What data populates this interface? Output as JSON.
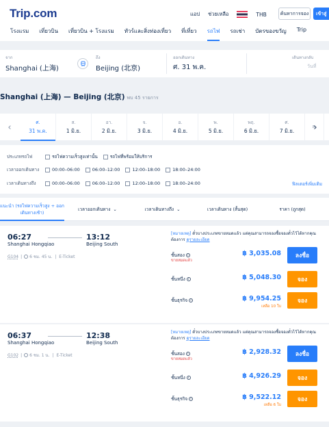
{
  "header": {
    "logo": "Trip.com",
    "links": [
      "แอป",
      "ช่วยเหลือ",
      "THB"
    ],
    "order_label": "ค้นหาการจอง",
    "login_label": "เข้าสู่"
  },
  "nav": [
    "โรงแรม",
    "เที่ยวบิน",
    "เที่ยวบิน + โรงแรม",
    "ทัวร์และสิ่งท่องเที่ยว",
    "ที่เที่ยว",
    "รถไฟ",
    "รถเช่า",
    "บัตรของขวัญ",
    "Trip"
  ],
  "search": {
    "from_label": "จาก",
    "from_value": "Shanghai (上海)",
    "to_label": "ถึง",
    "to_value": "Beijing (北京)",
    "depart_label": "ออกเดินทาง",
    "depart_value": "ศ. 31 พ.ค.",
    "return_label": "เดินทางกลับ",
    "return_value": "วันที่"
  },
  "route": {
    "title": "Shanghai (上海) — Beijing (北京)",
    "count": "พบ 45 รายการ"
  },
  "dates": [
    {
      "dow": "ศ.",
      "day": "31 พ.ค."
    },
    {
      "dow": "ส.",
      "day": "1 มิ.ย."
    },
    {
      "dow": "อา.",
      "day": "2 มิ.ย."
    },
    {
      "dow": "จ.",
      "day": "3 มิ.ย."
    },
    {
      "dow": "อ.",
      "day": "4 มิ.ย."
    },
    {
      "dow": "พ.",
      "day": "5 มิ.ย."
    },
    {
      "dow": "พฤ.",
      "day": "6 มิ.ย."
    },
    {
      "dow": "ศ.",
      "day": "7 มิ.ย."
    },
    {
      "dow": "ส.",
      "day": ""
    }
  ],
  "filters": {
    "type_label": "ประเภทรถไฟ",
    "type_opts": [
      "รถไฟความเร็วสูงเท่านั้น",
      "รถไฟที่พร้อมให้บริการ"
    ],
    "depart_label": "เวลาออกเดินทาง",
    "arrive_label": "เวลาเดินทางถึง",
    "time_opts": [
      "00:00–06:00",
      "06:00–12:00",
      "12:00–18:00",
      "18:00–24:00"
    ],
    "more": "ฟิลเตอร์เพิ่มเติม"
  },
  "sort": [
    "แนะนำ (รถไฟความเร็วสูง + ออกเดินทางเช้า)",
    "เวลาออกเดินทาง",
    "เวลาเดินทางถึง",
    "เวลาเดินทาง (สั้นสุด)",
    "ราคา (ถูกสุด)"
  ],
  "trains": [
    {
      "dep": "06:27",
      "arr": "13:12",
      "from": "Shanghai Hongqiao",
      "to": "Beijing South",
      "no": "G104",
      "dur": "6 ชม. 45 น.",
      "ticket": "E-Ticket",
      "note_tag": "[หมายเหตุ]",
      "note": " ตั๋วบางประเภทขายหมดแล้ว แต่คุณสามารถจองซื้อจองตั๋วไว้ได้หากคุณต้องการ ",
      "note_link": "ดูรายละเอียด",
      "classes": [
        {
          "name": "ชั้นสอง",
          "status": "ขายหมดแล้ว",
          "price": "฿ 3,035.08",
          "left": "",
          "btn": "ลงชื่อ",
          "btype": "blue"
        },
        {
          "name": "ชั้นหนึ่ง",
          "status": "",
          "price": "฿ 5,048.30",
          "left": "",
          "btn": "จอง",
          "btype": "orange"
        },
        {
          "name": "ชั้นธุรกิจ",
          "status": "",
          "price": "฿ 9,954.25",
          "left": "เหลือ 10 ใบ",
          "btn": "จอง",
          "btype": "orange"
        }
      ]
    },
    {
      "dep": "06:37",
      "arr": "12:38",
      "from": "Shanghai Hongqiao",
      "to": "Beijing South",
      "no": "G102",
      "dur": "6 ชม. 1 น.",
      "ticket": "E-Ticket",
      "note_tag": "[หมายเหตุ]",
      "note": " ตั๋วบางประเภทขายหมดแล้ว แต่คุณสามารถจองซื้อจองตั๋วไว้ได้หากคุณต้องการ ",
      "note_link": "ดูรายละเอียด",
      "classes": [
        {
          "name": "ชั้นสอง",
          "status": "ขายหมดแล้ว",
          "price": "฿ 2,928.32",
          "left": "",
          "btn": "ลงชื่อ",
          "btype": "blue"
        },
        {
          "name": "ชั้นหนึ่ง",
          "status": "",
          "price": "฿ 4,926.29",
          "left": "",
          "btn": "จอง",
          "btype": "orange"
        },
        {
          "name": "ชั้นธุรกิจ",
          "status": "",
          "price": "฿ 9,522.12",
          "left": "เหลือ 6 ใบ",
          "btn": "จอง",
          "btype": "orange"
        }
      ]
    }
  ],
  "colors": {
    "accent": "#287dfa",
    "book": "#ff9500",
    "soldout": "#e23b3b"
  }
}
